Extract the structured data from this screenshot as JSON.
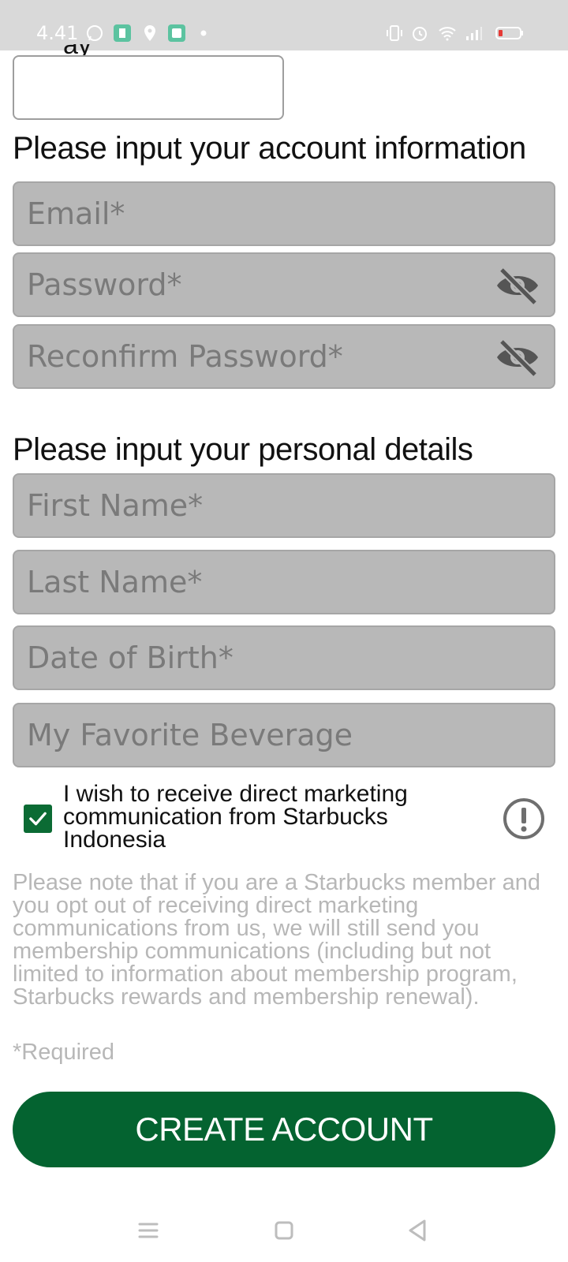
{
  "status_bar": {
    "time": "4.41",
    "icons": [
      "whatsapp-icon",
      "app-icon",
      "location-icon",
      "app-icon-2",
      "dot-icon",
      "vibrate-icon",
      "alarm-icon",
      "wifi-icon",
      "signal-icon",
      "battery-icon"
    ]
  },
  "sections": {
    "account_title": "Please input your account information",
    "personal_title": "Please input your personal details"
  },
  "fields": {
    "email_placeholder": "Email*",
    "password_placeholder": "Password*",
    "reconfirm_placeholder": "Reconfirm Password*",
    "first_name_placeholder": "First Name*",
    "last_name_placeholder": "Last Name*",
    "dob_placeholder": "Date of Birth*",
    "beverage_placeholder": "My Favorite Beverage"
  },
  "marketing": {
    "checked": true,
    "label": "I wish to receive direct marketing communication from Starbucks Indonesia"
  },
  "note": "Please note that if you are a Starbucks member and you opt out of receiving direct marketing communications from us, we will still send you membership communications (including but not limited to information about membership program, Starbucks rewards and membership renewal).",
  "required_note": "*Required",
  "create_button": "CREATE ACCOUNT",
  "colors": {
    "primary_green": "#046330",
    "checkbox_green": "#0b6b34",
    "field_bg": "#b8b8b8",
    "muted_text": "#b7b7b7"
  }
}
